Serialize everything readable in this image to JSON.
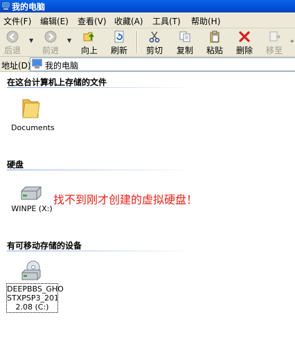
{
  "window": {
    "title": "我的电脑"
  },
  "menubar": {
    "items": [
      "文件(F)",
      "编辑(E)",
      "查看(V)",
      "收藏(A)",
      "工具(T)",
      "帮助(H)"
    ]
  },
  "toolbar": {
    "back": "后退",
    "forward": "前进",
    "up": "向上",
    "refresh": "刷新",
    "cut": "剪切",
    "copy": "复制",
    "paste": "粘贴",
    "delete": "删除",
    "move": "移至"
  },
  "address": {
    "label": "地址(D)",
    "value": "我的电脑"
  },
  "groups": {
    "files": {
      "title": "在这台计算机上存储的文件",
      "items": [
        {
          "label": "Documents",
          "icon": "folder-icon"
        }
      ]
    },
    "hdd": {
      "title": "硬盘",
      "items": [
        {
          "label": "WINPE (X:)",
          "icon": "hard-drive-icon"
        }
      ]
    },
    "removable": {
      "title": "有可移动存储的设备",
      "items": [
        {
          "label_lines": [
            "DEEPBBS_GHO",
            "STXPSP3_201",
            "2.08 (C:)"
          ],
          "icon": "cd-drive-icon"
        }
      ]
    }
  },
  "annotation": {
    "text": "找不到刚才创建的虚拟硬盘！",
    "color": "#e8231a"
  },
  "colors": {
    "titlebar": "#0050d8",
    "chrome": "#ece9d8"
  }
}
